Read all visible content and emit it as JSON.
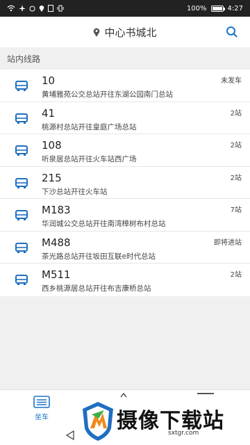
{
  "status_bar": {
    "battery": "100%",
    "time": "4:27"
  },
  "header": {
    "title": "中心书城北"
  },
  "section": {
    "label": "站内线路"
  },
  "routes": [
    {
      "route": "10",
      "dest": "黄埔雅苑公交总站开往东湖公园南门总站",
      "status": "未发车"
    },
    {
      "route": "41",
      "dest": "桃源村总站开往皇庭广场总站",
      "status": "2站"
    },
    {
      "route": "108",
      "dest": "听泉居总站开往火车站西广场",
      "status": "2站"
    },
    {
      "route": "215",
      "dest": "下沙总站开往火车站",
      "status": "2站"
    },
    {
      "route": "M183",
      "dest": "华润城公交总站开往南湾樟树布村总站",
      "status": "7站"
    },
    {
      "route": "M488",
      "dest": "茶光路总站开往坂田互联e时代总站",
      "status": "即将进站"
    },
    {
      "route": "M511",
      "dest": "西乡桃源居总站开往布吉康桥总站",
      "status": "2站"
    }
  ],
  "bottom_tabs": {
    "active_label": "坐车"
  },
  "watermark": {
    "text": "摄像下载站",
    "url": "sxtgr.com"
  },
  "colors": {
    "accent": "#1a73c8",
    "icon_blue": "#1e6fc2"
  },
  "icons": [
    "wifi-icon",
    "airplane-icon",
    "alarm-icon",
    "location-icon",
    "pin-icon",
    "search-icon",
    "bus-icon",
    "list-icon",
    "back-icon"
  ]
}
